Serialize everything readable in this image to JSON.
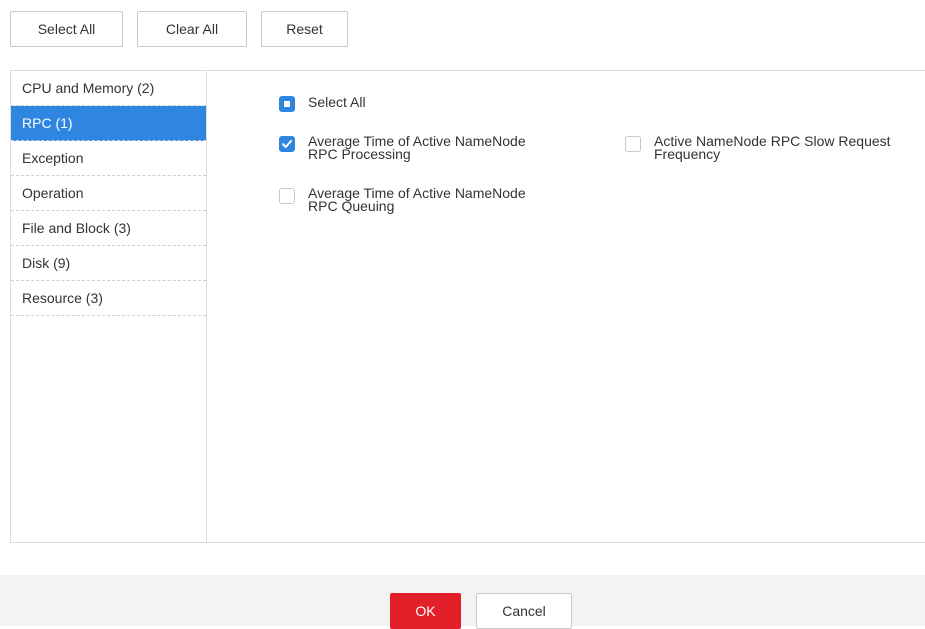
{
  "toolbar": {
    "select_all_label": "Select All",
    "clear_all_label": "Clear All",
    "reset_label": "Reset"
  },
  "sidebar": {
    "items": [
      {
        "label": "CPU and Memory (2)",
        "active": false
      },
      {
        "label": "RPC (1)",
        "active": true
      },
      {
        "label": "Exception",
        "active": false
      },
      {
        "label": "Operation",
        "active": false
      },
      {
        "label": "File and Block (3)",
        "active": false
      },
      {
        "label": "Disk (9)",
        "active": false
      },
      {
        "label": "Resource (3)",
        "active": false
      }
    ]
  },
  "metrics": {
    "select_all": {
      "label": "Select All",
      "state": "indeterminate"
    },
    "items": [
      {
        "label_line1": "Average Time of Active NameNode",
        "label_line2": "RPC Processing",
        "checked": true
      },
      {
        "label_line1": "Active NameNode RPC Slow Request",
        "label_line2": "Frequency",
        "checked": false
      },
      {
        "label_line1": "Average Time of Active NameNode",
        "label_line2": "RPC Queuing",
        "checked": false
      }
    ]
  },
  "footer": {
    "ok_label": "OK",
    "cancel_label": "Cancel"
  },
  "colors": {
    "accent": "#2f86e0",
    "ok_button": "#e3202a",
    "footer_bg": "#f3f3f3",
    "border": "#dcdcdc"
  }
}
